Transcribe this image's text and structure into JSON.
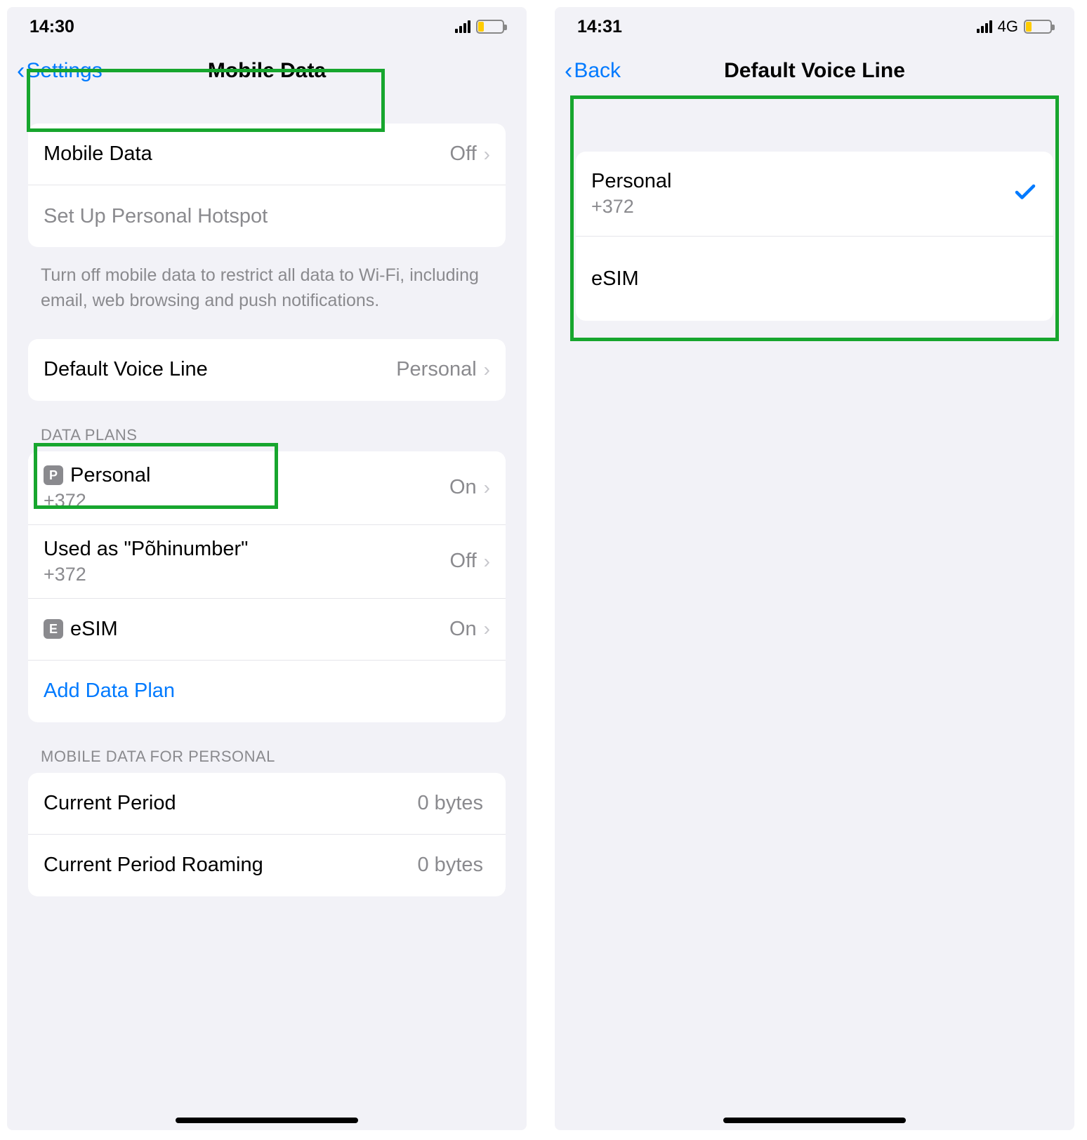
{
  "left": {
    "status": {
      "time": "14:30"
    },
    "nav": {
      "back": "Settings",
      "title": "Mobile Data"
    },
    "group1": {
      "mobile_data": {
        "label": "Mobile Data",
        "value": "Off"
      },
      "hotspot": {
        "label": "Set Up Personal Hotspot"
      },
      "footer": "Turn off mobile data to restrict all data to Wi-Fi, including email, web browsing and push notifications."
    },
    "group2": {
      "dvl": {
        "label": "Default Voice Line",
        "value": "Personal"
      }
    },
    "data_plans": {
      "header": "DATA PLANS",
      "personal": {
        "badge": "P",
        "label": "Personal",
        "sub": "+372",
        "value": "On"
      },
      "pohi": {
        "label": "Used as \"Põhinumber\"",
        "sub": "+372",
        "value": "Off"
      },
      "esim": {
        "badge": "E",
        "label": "eSIM",
        "value": "On"
      },
      "add": {
        "label": "Add Data Plan"
      }
    },
    "usage": {
      "header": "MOBILE DATA FOR PERSONAL",
      "current": {
        "label": "Current Period",
        "value": "0 bytes"
      },
      "roaming": {
        "label": "Current Period Roaming",
        "value": "0 bytes"
      }
    }
  },
  "right": {
    "status": {
      "time": "14:31",
      "net": "4G"
    },
    "nav": {
      "back": "Back",
      "title": "Default Voice Line"
    },
    "options": {
      "personal": {
        "label": "Personal",
        "sub": "+372",
        "selected": true
      },
      "esim": {
        "label": "eSIM",
        "selected": false
      }
    }
  }
}
